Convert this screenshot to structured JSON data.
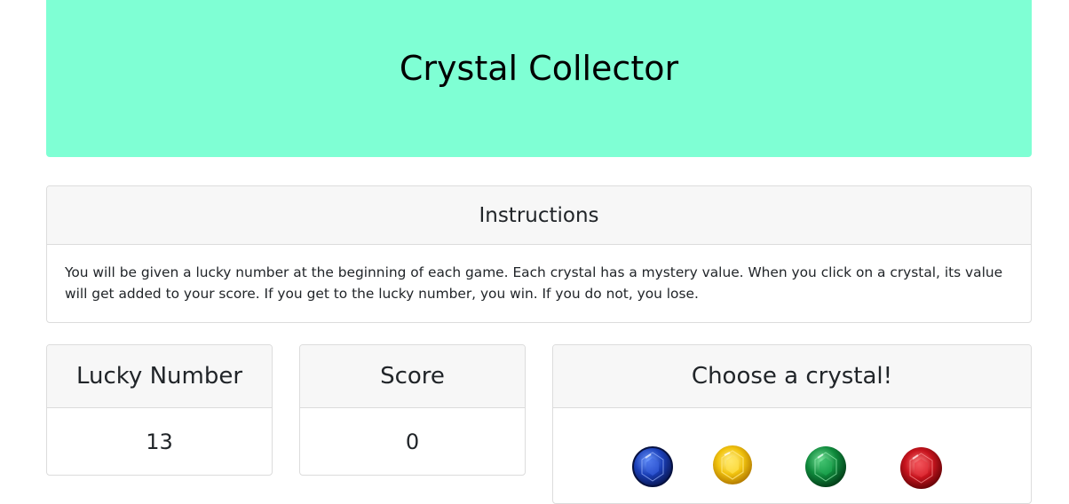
{
  "header": {
    "title": "Crystal Collector"
  },
  "instructions": {
    "title": "Instructions",
    "text": "You will be given a lucky number at the beginning of each game. Each crystal has a mystery value. When you click on a crystal, its value will get added to your score. If you get to the lucky number, you win. If you do not, you lose."
  },
  "lucky": {
    "title": "Lucky Number",
    "value": "13"
  },
  "score": {
    "title": "Score",
    "value": "0"
  },
  "crystals": {
    "title": "Choose a crystal!",
    "items": [
      {
        "name": "blue",
        "color": "#1a3fb8"
      },
      {
        "name": "yellow",
        "color": "#f2c40f"
      },
      {
        "name": "green",
        "color": "#0f8a3c"
      },
      {
        "name": "red",
        "color": "#c8141e"
      }
    ]
  }
}
